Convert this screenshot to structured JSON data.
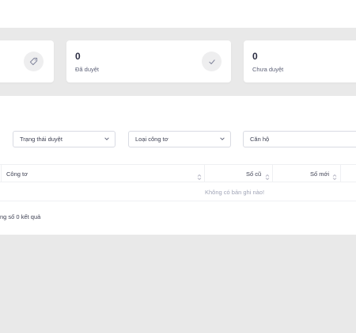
{
  "stats": [
    {
      "value": "",
      "label": "",
      "icon": "tag-icon"
    },
    {
      "value": "0",
      "label": "Đã duyệt",
      "icon": "check-icon"
    },
    {
      "value": "0",
      "label": "Chưa duyệt",
      "icon": ""
    }
  ],
  "filters": {
    "approval_status": "Trạng thái duyệt",
    "meter_type": "Loại công tơ",
    "apartment": "Căn hộ"
  },
  "table": {
    "columns": [
      "Công tơ",
      "Số cũ",
      "Số mới"
    ],
    "empty_message": "Không có bản ghi nào!"
  },
  "footer": {
    "summary": "ng số 0 kết quả"
  }
}
